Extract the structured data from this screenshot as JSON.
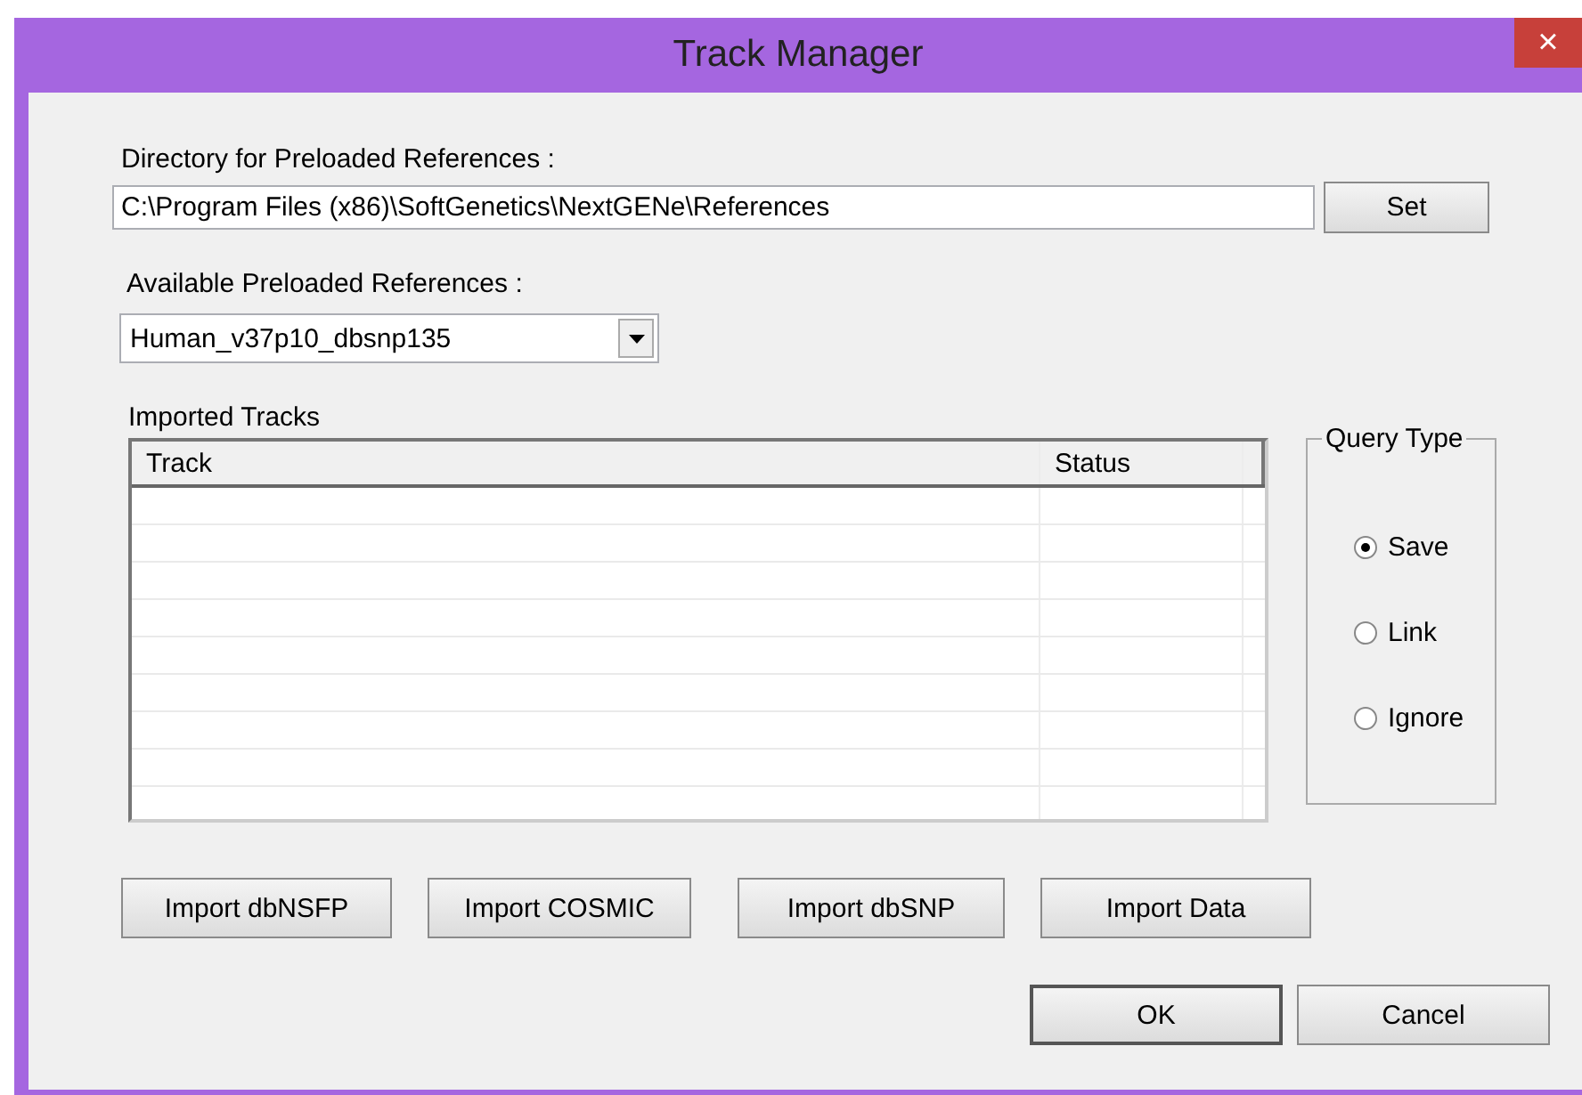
{
  "window": {
    "title": "Track Manager",
    "close": "×"
  },
  "directory": {
    "label": "Directory for Preloaded References :",
    "value": "C:\\Program Files (x86)\\SoftGenetics\\NextGENe\\References",
    "button": "Set"
  },
  "references": {
    "label": "Available Preloaded References :",
    "value": "Human_v37p10_dbsnp135"
  },
  "tracks": {
    "label": "Imported Tracks",
    "columns": [
      "Track",
      "Status"
    ]
  },
  "query_type": {
    "title": "Query Type",
    "options": [
      {
        "label": "Save",
        "selected": true
      },
      {
        "label": "Link",
        "selected": false
      },
      {
        "label": "Ignore",
        "selected": false
      }
    ]
  },
  "import_buttons": [
    "Import dbNSFP",
    "Import COSMIC",
    "Import dbSNP",
    "Import Data"
  ],
  "buttons": [
    "OK",
    "Cancel"
  ]
}
